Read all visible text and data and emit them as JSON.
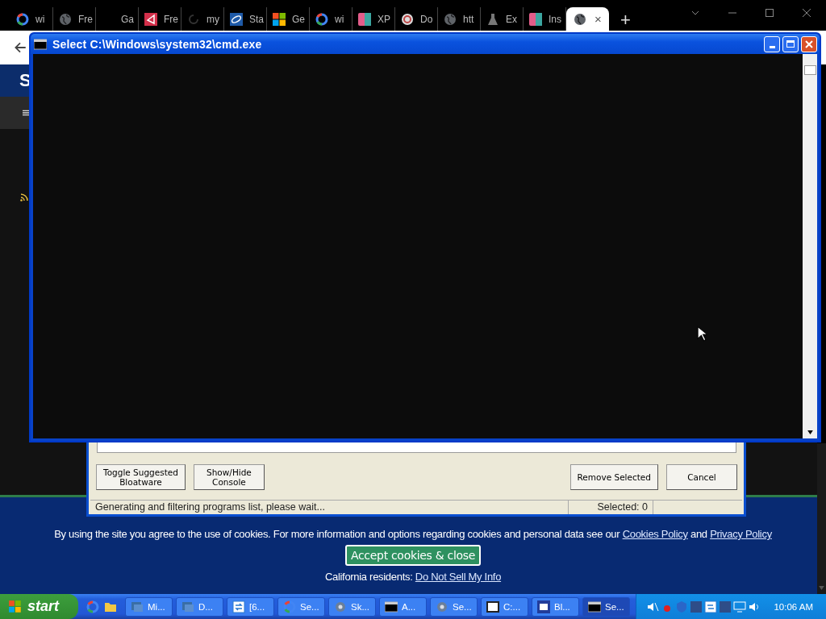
{
  "browser": {
    "tabs": [
      {
        "label": "wi",
        "kind": "ring",
        "selected": false
      },
      {
        "label": "Fre",
        "kind": "globe",
        "selected": false
      },
      {
        "label": "Ga",
        "kind": "blank",
        "selected": false
      },
      {
        "label": "Fre",
        "kind": "arrow",
        "selected": false
      },
      {
        "label": "my",
        "kind": "swirl",
        "selected": false
      },
      {
        "label": "Sta",
        "kind": "badge",
        "selected": false
      },
      {
        "label": "Ge",
        "kind": "squares",
        "selected": false
      },
      {
        "label": "wi",
        "kind": "ring",
        "selected": false
      },
      {
        "label": "XP",
        "kind": "tile",
        "selected": false
      },
      {
        "label": "Do",
        "kind": "spiral",
        "selected": false
      },
      {
        "label": "htt",
        "kind": "globe",
        "selected": false
      },
      {
        "label": "Ex",
        "kind": "flask",
        "selected": false
      },
      {
        "label": "Ins",
        "kind": "tile",
        "selected": false
      },
      {
        "kind": "globe",
        "close": "×",
        "selected": true
      }
    ],
    "new_tab": "+",
    "page": {
      "header_letter": "S"
    }
  },
  "console": {
    "title": "Select C:\\Windows\\system32\\cmd.exe"
  },
  "dialog": {
    "left_buttons": [
      "Toggle Suggested\nBloatware",
      "Show/Hide\nConsole"
    ],
    "right_buttons": [
      "Remove Selected",
      "Cancel"
    ],
    "status": "Generating and filtering programs list, please wait...",
    "selected_count": "Selected: 0"
  },
  "cookie_banner": {
    "sentence": [
      {
        "kind": "text",
        "text": "By using the site you agree to the use of cookies. For more information and options regarding cookies and personal data see our "
      },
      {
        "kind": "link",
        "text": "Cookies Policy"
      },
      {
        "kind": "text",
        "text": " and "
      },
      {
        "kind": "link",
        "text": "Privacy Policy"
      }
    ],
    "accept": "Accept cookies & close",
    "notice": [
      {
        "kind": "text",
        "text": "California residents: "
      },
      {
        "kind": "link",
        "text": "Do Not Sell My Info"
      }
    ]
  },
  "taskbar": {
    "start": "start",
    "tasks": [
      {
        "label": "Mi...",
        "kind": "windows",
        "selected": false
      },
      {
        "label": "D...",
        "kind": "windows",
        "selected": false
      },
      {
        "label": "[6...",
        "kind": "sync",
        "selected": false
      },
      {
        "label": "Se...",
        "kind": "ring",
        "selected": false
      },
      {
        "label": "Sk...",
        "kind": "gear",
        "selected": false
      },
      {
        "label": "A...",
        "kind": "console",
        "selected": false
      },
      {
        "label": "Se...",
        "kind": "gear",
        "selected": false
      },
      {
        "label": "C:...",
        "kind": "archive",
        "selected": false
      },
      {
        "label": "Bl...",
        "kind": "bru",
        "selected": false
      },
      {
        "label": "Se...",
        "kind": "console",
        "selected": true
      }
    ],
    "clock": "10:06 AM"
  }
}
